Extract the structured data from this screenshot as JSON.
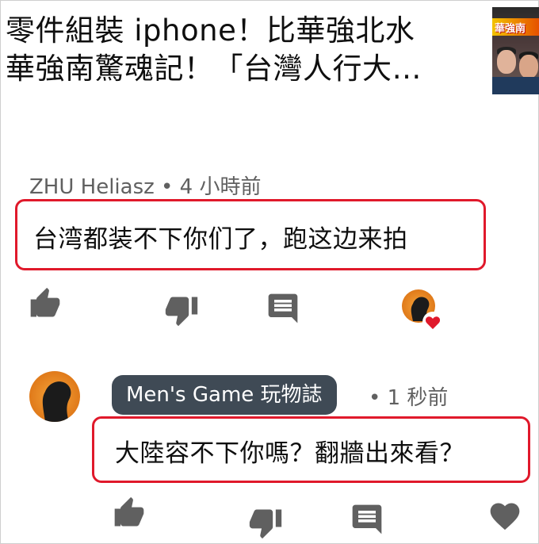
{
  "video": {
    "title_line1": "零件組裝 iphone！比華強北水",
    "title_line2": "華強南驚魂記！「台灣人行大…",
    "thumbnail_text": "華強南"
  },
  "comment1": {
    "author": "ZHU Heliasz",
    "separator": "•",
    "time": "4 小時前",
    "text": "台湾都装不下你们了，跑这边来拍"
  },
  "comment2": {
    "author": "Men's Game 玩物誌",
    "separator": "•",
    "time": "1 秒前",
    "text": "大陸容不下你嗎？翻牆出來看？"
  },
  "icons": {
    "like": "thumbs-up-icon",
    "dislike": "thumbs-down-icon",
    "reply": "comment-icon",
    "heart": "heart-icon"
  },
  "colors": {
    "highlight_border": "#e0192b",
    "icon_gray": "#606060",
    "heart_red": "#e0192b",
    "author_pill": "#3f4a55",
    "avatar_orange": "#f6a53a"
  }
}
